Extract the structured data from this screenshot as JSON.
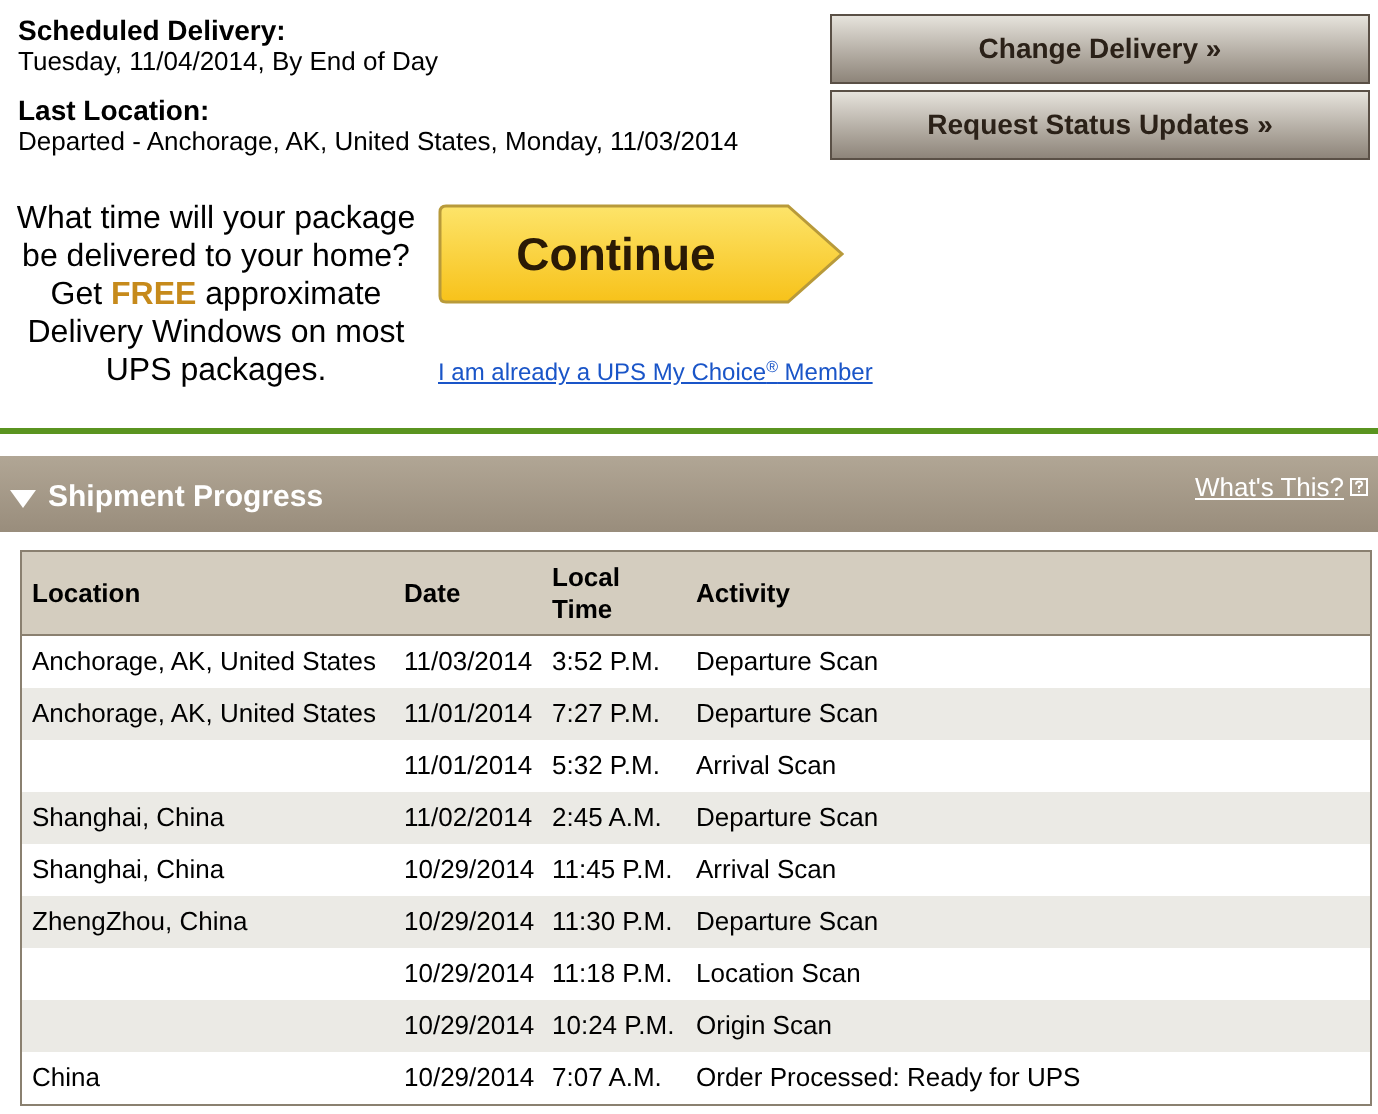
{
  "delivery": {
    "scheduled_label": "Scheduled Delivery:",
    "scheduled_value": "Tuesday, 11/04/2014, By End of Day",
    "last_label": "Last Location:",
    "last_value": "Departed - Anchorage, AK, United States, Monday, 11/03/2014"
  },
  "buttons": [
    "Change Delivery »",
    "Request Status Updates »"
  ],
  "promo": {
    "text": "What time will your package be delivered to your home? Get **FREE** approximate Delivery Windows on most UPS packages.",
    "button": "Continue",
    "link": "I am already a UPS My Choice$^{®}$ Member"
  },
  "section": {
    "title": "Shipment Progress",
    "expanded": true,
    "help_link": "What's This?"
  },
  "table": {
    "columns": [
      "Location",
      "Date",
      "Local Time",
      "Activity"
    ],
    "rows": [
      [
        "Anchorage, AK, United States",
        "11/03/2014",
        "3:52 P.M.",
        "Departure Scan"
      ],
      [
        "Anchorage, AK, United States",
        "11/01/2014",
        "7:27 P.M.",
        "Departure Scan"
      ],
      [
        "",
        "11/01/2014",
        "5:32 P.M.",
        "Arrival Scan"
      ],
      [
        "Shanghai, China",
        "11/02/2014",
        "2:45 A.M.",
        "Departure Scan"
      ],
      [
        "Shanghai, China",
        "10/29/2014",
        "11:45 P.M.",
        "Arrival Scan"
      ],
      [
        "ZhengZhou, China",
        "10/29/2014",
        "11:30 P.M.",
        "Departure Scan"
      ],
      [
        "",
        "10/29/2014",
        "11:18 P.M.",
        "Location Scan"
      ],
      [
        "",
        "10/29/2014",
        "10:24 P.M.",
        "Origin Scan"
      ],
      [
        "China",
        "10/29/2014",
        "7:07 A.M.",
        "Order Processed: Ready for UPS"
      ]
    ]
  }
}
